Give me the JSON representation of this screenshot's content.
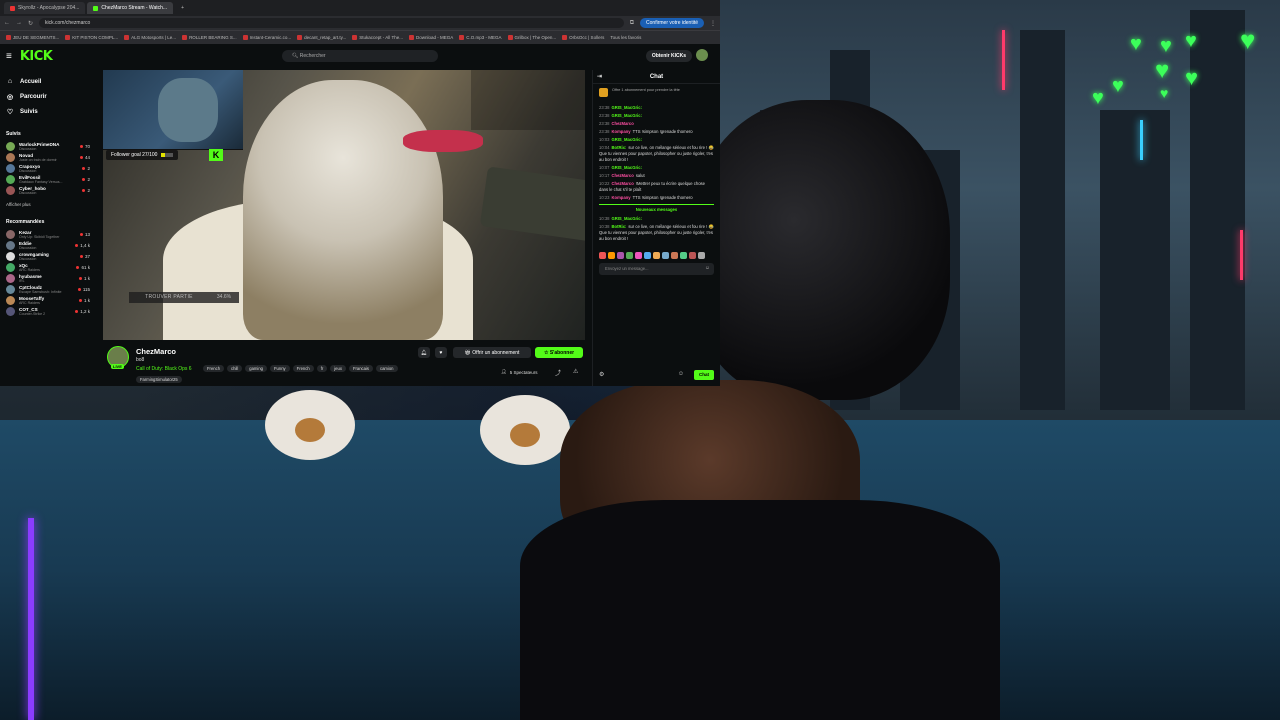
{
  "browser": {
    "tabs": [
      {
        "label": "Skyrollz - Apocalypse 204..."
      },
      {
        "label": "ChezMarco Stream - Watch..."
      }
    ],
    "url": "kick.com/chezmarco",
    "verify_label": "Confirmer votre identité",
    "bookmarks": [
      "JEU DE SEGMENTS...",
      "KIT PISTON COMPL...",
      "ALG Motosports | Le...",
      "ROLLER BEARING S...",
      "Instant-Ceramic.co...",
      "decant_retap_art.ty...",
      "Stukaccept - All The...",
      "Download - MEGA",
      "C.O.mp3 - MEGA",
      "Grilbox | The Open...",
      "OrbsOcc | Sollers",
      "Tous les favoris"
    ]
  },
  "kick": {
    "logo": "KICK",
    "search_placeholder": "Rechercher",
    "obtenir_label": "Obtenir KICKs"
  },
  "sidebar": {
    "main": [
      {
        "label": "Accueil",
        "icon": "home-icon"
      },
      {
        "label": "Parcourir",
        "icon": "compass-icon"
      },
      {
        "label": "Suivis",
        "icon": "heart-icon"
      }
    ],
    "followed_heading": "Suivis",
    "followed": [
      {
        "name": "WarlockPrimeDNA",
        "category": "Discussion",
        "viewers": "70"
      },
      {
        "name": "Novad",
        "category": "Juste on train de dormir",
        "viewers": "44"
      },
      {
        "name": "Crapoxyo",
        "category": "Discussion",
        "viewers": "2"
      },
      {
        "name": "EvilFossil",
        "category": "Gratdaux Fantasy Versus...",
        "viewers": "2"
      },
      {
        "name": "Cyber_hobo",
        "category": "Discussion",
        "viewers": "2"
      }
    ],
    "show_more": "Afficher plus",
    "recommended_heading": "Recommandées",
    "recommended": [
      {
        "name": "Kezar",
        "category": "Only Up: Skibidi Together",
        "viewers": "13"
      },
      {
        "name": "Eddie",
        "category": "Discussion",
        "viewers": "1,4 k"
      },
      {
        "name": "crowngaming",
        "category": "Discussion",
        "viewers": "37"
      },
      {
        "name": "xQc",
        "category": "ARC Raiders",
        "viewers": "61 k"
      },
      {
        "name": "hyubasme",
        "category": "IRL",
        "viewers": "1 k"
      },
      {
        "name": "CptCloudz",
        "category": "Escape Samsbush: Infinite",
        "viewers": "115"
      },
      {
        "name": "MooseTaffy",
        "category": "ARC Raiders",
        "viewers": "1 k"
      },
      {
        "name": "COT_CS",
        "category": "Counter-Strike 2",
        "viewers": "1,2 k"
      }
    ]
  },
  "player": {
    "follower_goal_label": "Follower goal 27/100",
    "follower_goal_fraction": 0.27,
    "trouver_label": "TROUVER PARTIE",
    "percent_label": "34.6%"
  },
  "stream": {
    "name": "ChezMarco",
    "title": "bo8",
    "game": "Call of Duty: Black Ops 6",
    "tags": [
      "French",
      "chill",
      "gaming",
      "Funny",
      "French",
      "fr",
      "jeux",
      "Francais",
      "camion"
    ],
    "tag_extra": "FarmingSimulator25",
    "live_label": "LIVE",
    "gift_sub_label": "Offrir un abonnement",
    "subscribe_label": "S'abonner",
    "viewers_label": "5 Spectateurs"
  },
  "chat": {
    "title": "Chat",
    "gift_text": "Offre 1 abonnement pour prendre la tête",
    "messages": [
      {
        "time": "23:38",
        "user": "GRIS_MacGric:",
        "text": "",
        "color": "#53fc18"
      },
      {
        "time": "23:38",
        "user": "GRIS_MacGric:",
        "text": "",
        "color": "#53fc18"
      },
      {
        "time": "23:38",
        "user": "ChezMarco",
        "text": "",
        "color": "#ff4fa3"
      },
      {
        "time": "23:38",
        "user": "Kompany",
        "text": "TTS !simpson !grenade thomero",
        "color": "#ff4fa3"
      },
      {
        "time": "10:03",
        "user": "GRIS_MacGric:",
        "text": "",
        "color": "#53fc18"
      },
      {
        "time": "10:04",
        "user": "BotRix:",
        "text": "sur ce live, on mélange sérieux et fou rire ! 😂 Que tu viennes pour papoter, philosopher ou juste rigoler, t'es au bon endroit !",
        "color": "#53fc18"
      },
      {
        "time": "10:07",
        "user": "GRIS_MacGric:",
        "text": "",
        "color": "#53fc18"
      },
      {
        "time": "10:17",
        "user": "ChezMarco",
        "text": "salut",
        "color": "#ff4fa3"
      },
      {
        "time": "10:22",
        "user": "ChezMarco",
        "text": "!Mettre! peux tu écrire quelque chose dans le chat s'il te plaît",
        "color": "#ff4fa3"
      },
      {
        "time": "10:23",
        "user": "Kompany",
        "text": "TTS !simpson !grenade thomero",
        "color": "#ff4fa3"
      }
    ],
    "new_messages_label": "Nouveaux messages",
    "new_messages": [
      {
        "time": "10:38",
        "user": "GRIS_MacGric:",
        "text": "",
        "color": "#53fc18"
      },
      {
        "time": "10:38",
        "user": "BotRix:",
        "text": "sur ce live, on mélange sérieux et fou rire ! 😂 Que tu viennes pour papoter, philosopher ou juste rigoler, t'es au bon endroit !",
        "color": "#53fc18"
      }
    ],
    "input_placeholder": "Envoyez un message...",
    "send_label": "Chat"
  }
}
